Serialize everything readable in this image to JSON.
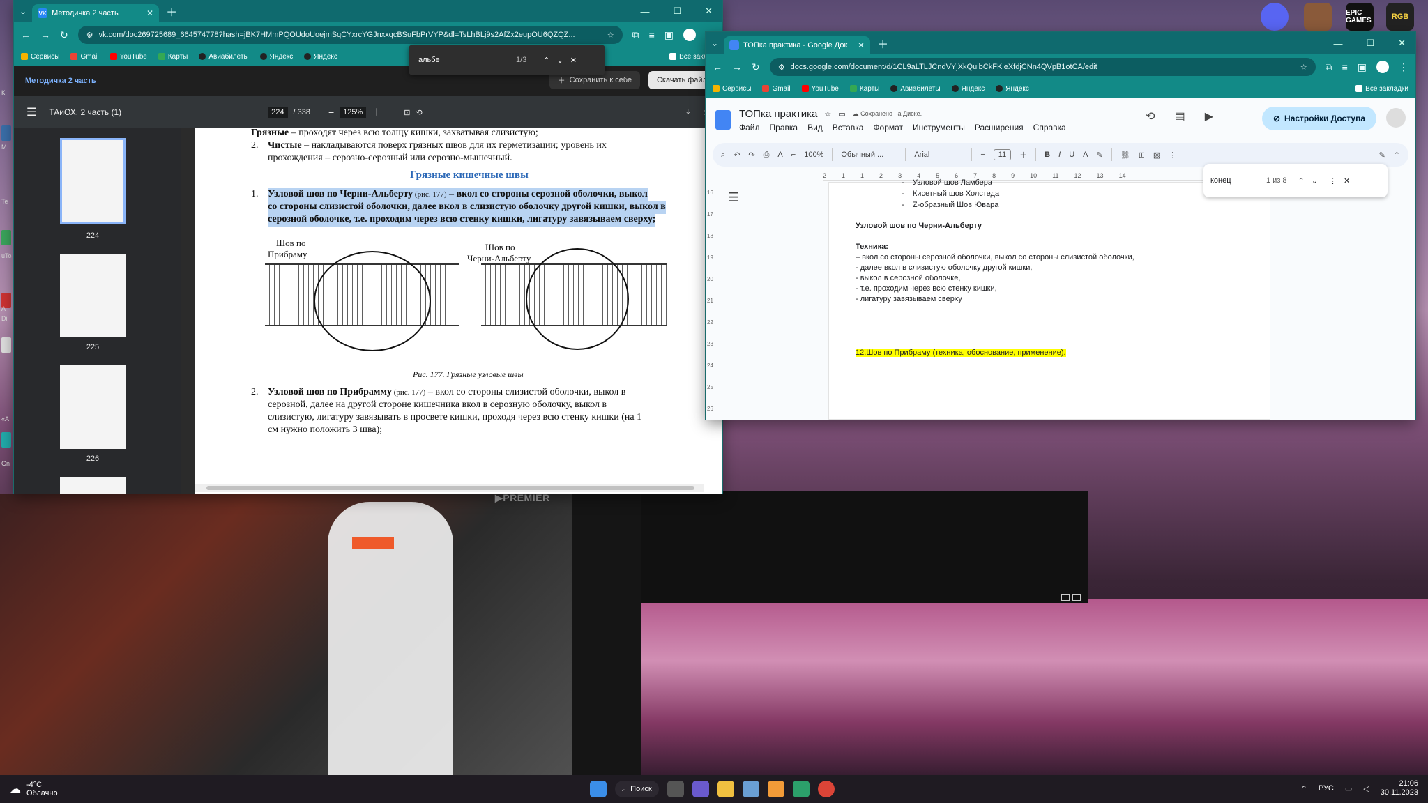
{
  "desktop": {
    "left_labels": [
      "К",
      "М",
      "Te",
      "uTo",
      "A",
      "Di",
      "«A",
      "Gn"
    ],
    "video_watermark": "▶PREMIER",
    "top_right_icons": [
      {
        "name": "discord-icon",
        "color": "#5865f2"
      },
      {
        "name": "avatar-app-icon",
        "color": "#8a5a3a"
      },
      {
        "name": "epic-games-icon",
        "color": "#111111",
        "label": "EPIC GAMES"
      },
      {
        "name": "rgb-app-icon",
        "color": "#222222",
        "label": "RGB"
      }
    ]
  },
  "vk_window": {
    "tab_title": "Методичка 2 часть",
    "tab_favicon": "VK",
    "url": "vk.com/doc269725689_664574778?hash=jBK7HMmPQOUdoUoejmSqCYxrcYGJnxxqcBSuFbPrVYP&dl=TsLhBLj9s2AfZx2eupOU6QZQZ...",
    "bookmarks": [
      "Сервисы",
      "Gmail",
      "YouTube",
      "Карты",
      "Авиабилеты",
      "Яндекс",
      "Яндекс",
      "Все заклад"
    ],
    "find": {
      "query": "альбе",
      "count": "1/3"
    },
    "header_title": "Методичка 2 часть",
    "save_button": "Сохранить к себе",
    "download_button": "Скачать файл",
    "pdf": {
      "doc_title": "ТАиОХ. 2 часть (1)",
      "page_current": "224",
      "page_total": "/ 338",
      "zoom": "125%",
      "thumbs": [
        "224",
        "225",
        "226"
      ],
      "lines": {
        "l1_bold": "Грязные",
        "l1_rest": " – проходят через всю толщу кишки, захватывая слизистую;",
        "l2_num": "2.",
        "l2_bold": "Чистые",
        "l2_rest": " – накладываются поверх грязных швов для их герметизации; уровень их",
        "l3": "прохождения – серозно-серозный или серозно-мышечный.",
        "heading": "Грязные кишечные швы",
        "p1_num": "1.",
        "p1_a": "Узловой шов по Черни-Альберту",
        "p1_ref": " (рис. 177)",
        "p1_b": " – вкол со стороны серозной оболочки, выкол",
        "p1_c": "со стороны слизистой оболочки, далее вкол в слизистую оболочку другой кишки, выкол в",
        "p1_d": "серозной оболочке, т.е. проходим через всю стенку кишки, лигатуру завязываем сверху;",
        "fig_label_left_1": "Шов по",
        "fig_label_left_2": "Прибраму",
        "fig_label_right_1": "Шов по",
        "fig_label_right_2": "Черни-Альберту",
        "caption": "Рис. 177. Грязные узловые швы",
        "p2_num": "2.",
        "p2_bold": "Узловой шов по Прибрамму",
        "p2_ref": " (рис. 177)",
        "p2_a": " – вкол со стороны слизистой оболочки, выкол в",
        "p2_b": "серозной, далее на другой стороне кишечника вкол в серозную оболочку, выкол в",
        "p2_c": "слизистую, лигатуру завязывать в просвете кишки, проходя через всю стенку кишки (на 1",
        "p2_d": "см нужно положить 3 шва);"
      }
    }
  },
  "docs_window": {
    "tab_title": "ТОПка практика - Google Док",
    "url": "docs.google.com/document/d/1CL9aLTLJCndVYjXkQuibCkFKleXfdjCNn4QVpB1otCA/edit",
    "bookmarks": [
      "Сервисы",
      "Gmail",
      "YouTube",
      "Карты",
      "Авиабилеты",
      "Яндекс",
      "Яндекс",
      "Все закладки"
    ],
    "doc_title": "ТОПка практика",
    "saved_status": "Сохранено на Диске.",
    "menu": [
      "Файл",
      "Правка",
      "Вид",
      "Вставка",
      "Формат",
      "Инструменты",
      "Расширения",
      "Справка"
    ],
    "share_button": "Настройки Доступа",
    "toolbar": {
      "zoom": "100%",
      "style": "Обычный ...",
      "font": "Arial",
      "size": "11"
    },
    "ruler": [
      "2",
      "1",
      "1",
      "2",
      "3",
      "4",
      "5",
      "6",
      "7",
      "8",
      "9",
      "10",
      "11",
      "12",
      "13",
      "14"
    ],
    "vruler": [
      "16",
      "17",
      "18",
      "19",
      "20",
      "21",
      "22",
      "23",
      "24",
      "25",
      "26"
    ],
    "find": {
      "query": "конец",
      "count": "1 из 8"
    },
    "content": {
      "b1": "Узловой шов Ламбера",
      "b2": "Кисетный шов Холстеда",
      "b3": "Z-образный Шов Ювара",
      "heading": "Узловой шов по Черни-Альберту",
      "tech": "Техника:",
      "t1": "– вкол со стороны серозной оболочки, выкол со стороны слизистой оболочки,",
      "t2": "- далее вкол в слизистую оболочку другой кишки,",
      "t3": "- выкол в серозной оболочке,",
      "t4": "- т.е. проходим через всю стенку кишки,",
      "t5": "- лигатуру завязываем сверху",
      "highlight": "12.Шов по Прибраму (техника, обоснование, применение).",
      "highlight_color": "#ffff00"
    }
  },
  "taskbar": {
    "weather_temp": "-4°C",
    "weather_text": "Облачно",
    "search": "Поиск",
    "lang": "РУС",
    "time": "21:06",
    "date": "30.11.2023"
  }
}
